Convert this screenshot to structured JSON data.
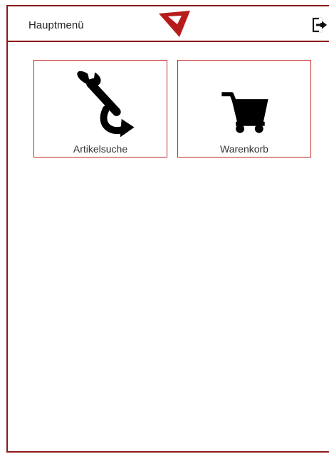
{
  "header": {
    "title": "Hauptmenü",
    "logo_icon": "red-triangle-logo-icon",
    "logout_icon": "logout-icon"
  },
  "tiles": [
    {
      "label": "Artikelsuche",
      "icon": "wrench-arrow-icon"
    },
    {
      "label": "Warenkorb",
      "icon": "shopping-cart-icon"
    }
  ],
  "colors": {
    "brand": "#b71c1c",
    "frame": "#8b1a1a",
    "tile_border": "#c62828"
  }
}
